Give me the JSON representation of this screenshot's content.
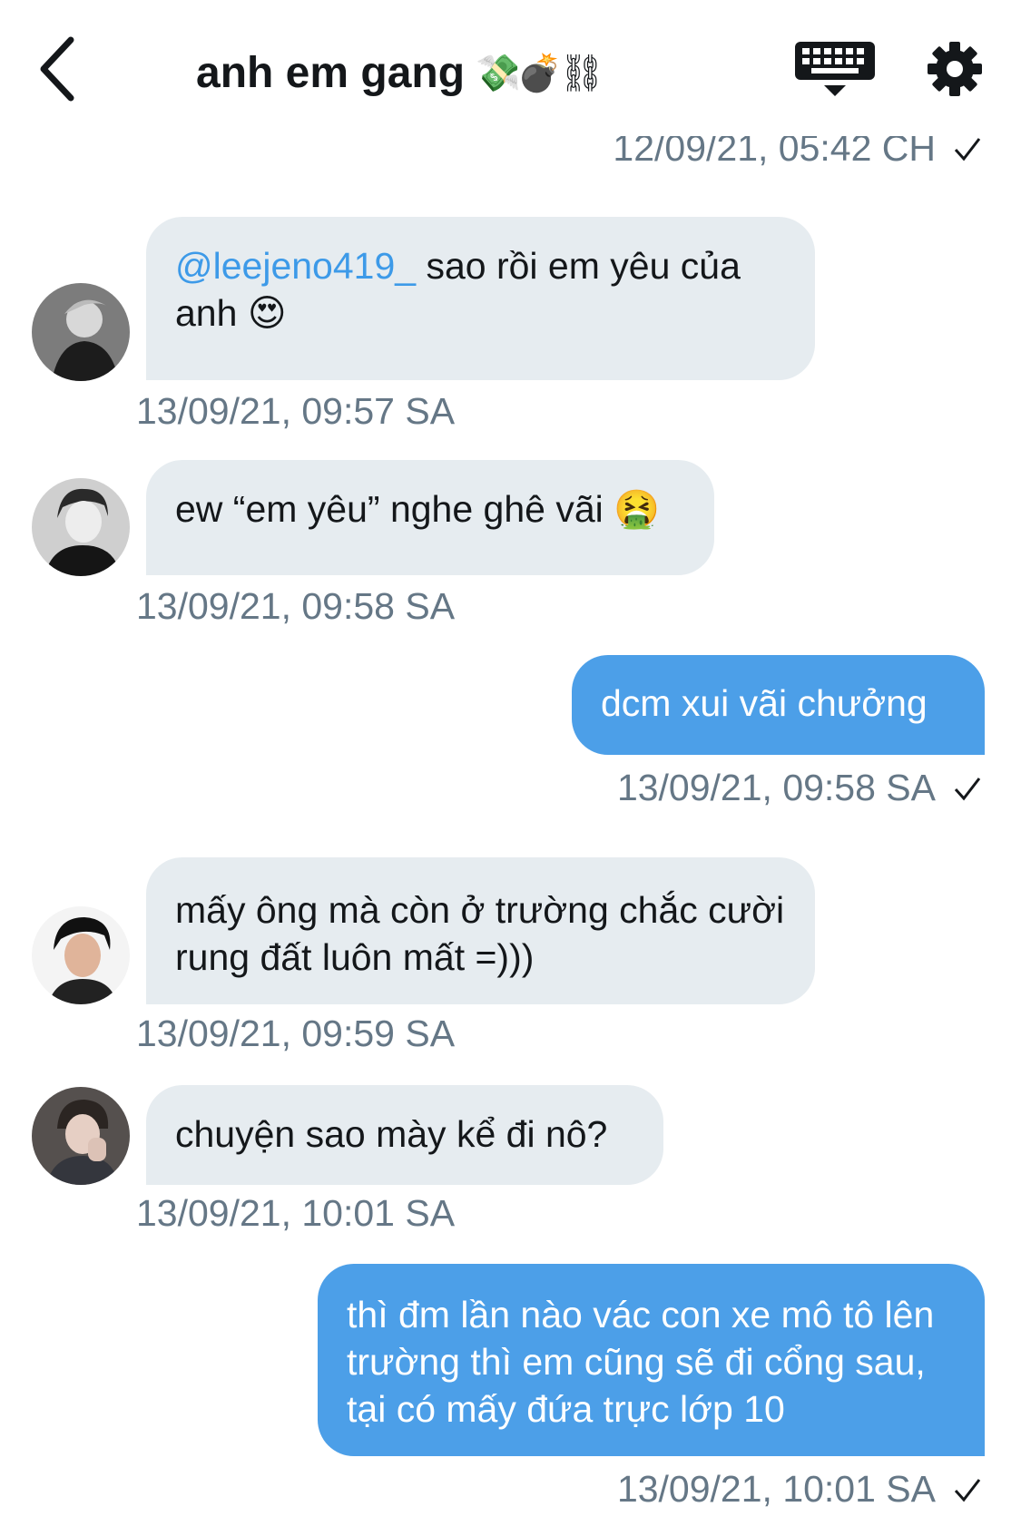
{
  "header": {
    "title": "anh em gang",
    "title_emojis": "💸💣⛓",
    "back_icon": "chevron-left-icon",
    "keyboard_icon": "keyboard-icon",
    "settings_icon": "gear-icon"
  },
  "previous_timestamp": "12/09/21, 05:42 CH",
  "messages": [
    {
      "direction": "incoming",
      "mention": "@leejeno419_",
      "text": "sao rồi em yêu của anh",
      "emoji": "😍",
      "timestamp": "13/09/21, 09:57 SA"
    },
    {
      "direction": "incoming",
      "text": "ew “em yêu” nghe ghê vãi",
      "emoji": "🤮",
      "timestamp": "13/09/21, 09:58 SA"
    },
    {
      "direction": "outgoing",
      "text": "dcm xui vãi chưởng",
      "timestamp": "13/09/21, 09:58 SA"
    },
    {
      "direction": "incoming",
      "text": "mấy ông mà còn ở trường chắc cười rung đất luôn mất =)))",
      "timestamp": "13/09/21, 09:59 SA"
    },
    {
      "direction": "incoming",
      "text": "chuyện sao mày kể đi nô?",
      "timestamp": "13/09/21, 10:01 SA"
    },
    {
      "direction": "outgoing",
      "text": "thì đm lần nào vác con xe mô tô lên trường thì em cũng sẽ đi cổng sau, tại có mấy đứa trực lớp 10",
      "timestamp": "13/09/21, 10:01 SA"
    }
  ],
  "colors": {
    "incoming_bubble": "#e6ecf0",
    "outgoing_bubble": "#4c9fe8",
    "mention": "#3d9ae8",
    "timestamp": "#657786"
  }
}
